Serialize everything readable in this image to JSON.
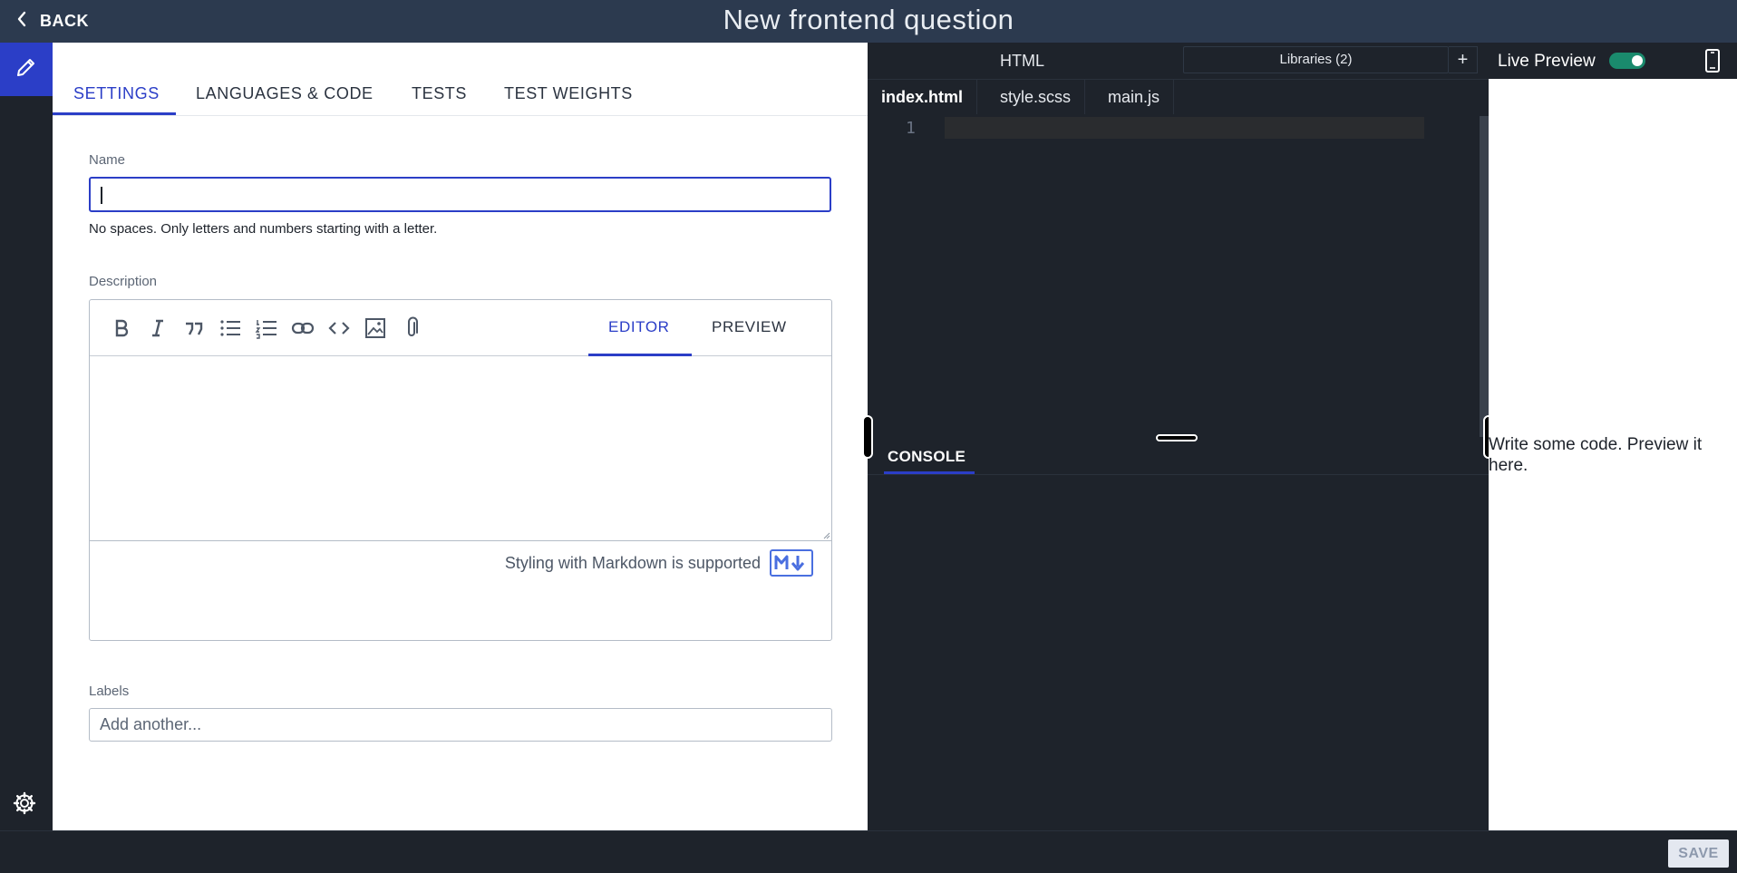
{
  "header": {
    "back_label": "BACK",
    "title": "New frontend question"
  },
  "rail": {
    "active_icon": "pencil-icon",
    "bottom_icon": "gear-icon"
  },
  "settings": {
    "tabs": [
      {
        "label": "SETTINGS",
        "active": true
      },
      {
        "label": "LANGUAGES & CODE",
        "active": false
      },
      {
        "label": "TESTS",
        "active": false
      },
      {
        "label": "TEST WEIGHTS",
        "active": false
      }
    ],
    "name": {
      "label": "Name",
      "value": "",
      "hint": "No spaces. Only letters and numbers starting with a letter."
    },
    "description": {
      "label": "Description",
      "toolbar_icons": [
        "bold-icon",
        "italic-icon",
        "quote-icon",
        "bulleted-list-icon",
        "numbered-list-icon",
        "link-icon",
        "code-icon",
        "image-icon",
        "attachment-icon"
      ],
      "editor_tab": "EDITOR",
      "preview_tab": "PREVIEW",
      "active_tab": "EDITOR",
      "markdown_note": "Styling with Markdown is supported",
      "markdown_badge": "markdown-icon"
    },
    "labels": {
      "label": "Labels",
      "placeholder": "Add another..."
    }
  },
  "code": {
    "language": "HTML",
    "libraries_label": "Libraries (2)",
    "add_library": "+",
    "files": [
      {
        "name": "index.html",
        "active": true
      },
      {
        "name": "style.scss",
        "active": false
      },
      {
        "name": "main.js",
        "active": false
      }
    ],
    "line_numbers": [
      "1"
    ],
    "console_tab": "CONSOLE"
  },
  "preview": {
    "label": "Live Preview",
    "toggle_on": true,
    "device_icon": "mobile-device-icon",
    "message": "Write some code. Preview it here."
  },
  "footer": {
    "save_label": "SAVE"
  },
  "colors": {
    "accent": "#2b3ec7",
    "topbar": "#2c3a4f",
    "dark_bg": "#1e232b",
    "toggle_on": "#1a8a6d"
  }
}
